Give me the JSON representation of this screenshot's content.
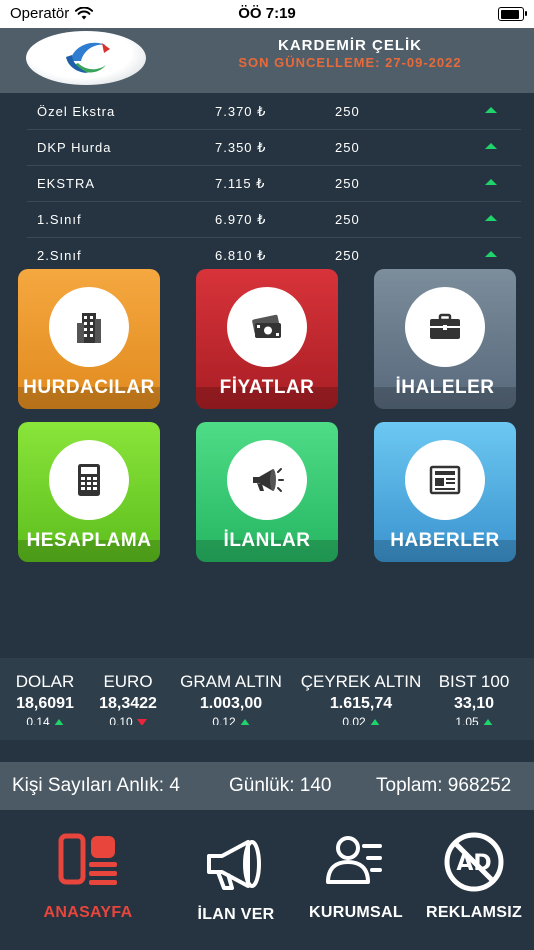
{
  "status_bar": {
    "carrier": "Operatör",
    "time": "ÖÖ 7:19"
  },
  "header": {
    "title": "KARDEMİR ÇELİK",
    "subtitle": "SON GÜNCELLEME: 27-09-2022"
  },
  "prices": [
    {
      "name": "Özel Ekstra",
      "price": "7.370 ₺",
      "qty": "250"
    },
    {
      "name": "DKP Hurda",
      "price": "7.350 ₺",
      "qty": "250"
    },
    {
      "name": "EKSTRA",
      "price": "7.115 ₺",
      "qty": "250"
    },
    {
      "name": "1.Sınıf",
      "price": "6.970 ₺",
      "qty": "250"
    },
    {
      "name": "2.Sınıf",
      "price": "6.810 ₺",
      "qty": "250"
    }
  ],
  "tiles": [
    {
      "label": "HURDACILAR",
      "icon": "building-icon"
    },
    {
      "label": "FİYATLAR",
      "icon": "money-icon"
    },
    {
      "label": "İHALELER",
      "icon": "briefcase-icon"
    },
    {
      "label": "HESAPLAMA",
      "icon": "calculator-icon"
    },
    {
      "label": "İLANLAR",
      "icon": "megaphone-icon"
    },
    {
      "label": "HABERLER",
      "icon": "newspaper-icon"
    }
  ],
  "ticker": [
    {
      "name": "DOLAR",
      "value": "18,6091",
      "change": "0,14",
      "direction": "up"
    },
    {
      "name": "EURO",
      "value": "18,3422",
      "change": "0,10",
      "direction": "down"
    },
    {
      "name": "GRAM ALTIN",
      "value": "1.003,00",
      "change": "0,12",
      "direction": "up"
    },
    {
      "name": "ÇEYREK ALTIN",
      "value": "1.615,74",
      "change": "0,02",
      "direction": "up"
    },
    {
      "name": "BIST 100",
      "value": "33,10",
      "change": "1,05",
      "direction": "up"
    }
  ],
  "stats": {
    "instant": "Kişi Sayıları Anlık: 4",
    "daily": "Günlük: 140",
    "total": "Toplam: 968252"
  },
  "nav": [
    {
      "label": "ANASAYFA",
      "icon": "home-icon",
      "active": true
    },
    {
      "label": "İLAN VER",
      "icon": "megaphone-outline-icon",
      "active": false
    },
    {
      "label": "KURUMSAL",
      "icon": "user-list-icon",
      "active": false
    },
    {
      "label": "REKLAMSIZ",
      "icon": "no-ads-icon",
      "active": false
    }
  ],
  "colors": {
    "background": "#253440",
    "header": "#4f5e69",
    "subtitle": "#e86a3a",
    "up": "#1fd46b",
    "down": "#e8253a",
    "active_nav": "#e8453c"
  }
}
